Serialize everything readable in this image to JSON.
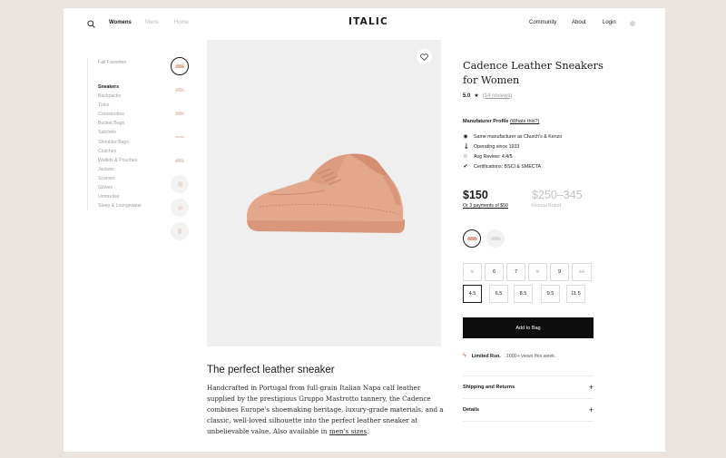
{
  "header": {
    "nav": [
      "Womens",
      "Mens",
      "Home"
    ],
    "logo": "ITALIC",
    "right_nav": [
      "Community",
      "About",
      "Login"
    ]
  },
  "sidebar": {
    "favorites": "Fall Favorites",
    "categories": [
      "Sneakers",
      "Backpacks",
      "Totes",
      "Crossbodies",
      "Bucket Bags",
      "Satchels",
      "Shoulder Bags",
      "Clutches",
      "Wallets & Pouches",
      "Jackets",
      "Scarves",
      "Gloves",
      "Umbrellas",
      "Sleep & Loungewear"
    ],
    "active_category": "Sneakers"
  },
  "product": {
    "title": "Cadence Leather Sneakers for Women",
    "rating": "5.0",
    "reviews": "(14 reviews)",
    "manufacturer_label": "Manufaturer Profile",
    "manufacturer_link": "(Whats this?)",
    "manufacturer_items": [
      {
        "icon": "eye-icon",
        "text": "Same manufacturer as Church's & Kenzo"
      },
      {
        "icon": "thermometer-icon",
        "text": "Operating since 1933"
      },
      {
        "icon": "star-outline-icon",
        "text": "Avg Review: 4.4/5"
      },
      {
        "icon": "check-icon",
        "text": "Certifications: BSCI & SMECTA"
      }
    ],
    "price": "$150",
    "installments": "Or 3 payments of $50",
    "retail_price": "$250–345",
    "retail_label": "Normal Brand",
    "colors": [
      "#e0a88c",
      "#e8e8e8"
    ],
    "sizes_row1": [
      "5",
      "6",
      "7",
      "8",
      "9",
      "10"
    ],
    "sizes_row1_disabled": [
      true,
      false,
      false,
      true,
      false,
      true
    ],
    "sizes_row2": [
      "4.5",
      "6.5",
      "8.5",
      "9.5",
      "11.5"
    ],
    "selected_size": "4.5",
    "add_to_bag": "Add to Bag",
    "limited_label": "Limited Run.",
    "limited_text": "1000+ views this week.",
    "accordions": [
      "Shipping and Returns",
      "Details"
    ]
  },
  "description": {
    "title": "The perfect leather sneaker",
    "body": "Handcrafted in Portugal from full-grain Italian Napa calf leather supplied by the prestigious Gruppo Mastrotto tannery, the Cadence combines Europe's shoemaking heritage, luxury-grade materials, and a classic, well-loved silhouette into the perfect leather sneaker at unbelievable value. Also available in ",
    "link": "men's sizes",
    "end": "."
  },
  "colors": {
    "accent": "#e0a88c",
    "button": "#0d0d0d",
    "bolt": "#e8604c"
  }
}
